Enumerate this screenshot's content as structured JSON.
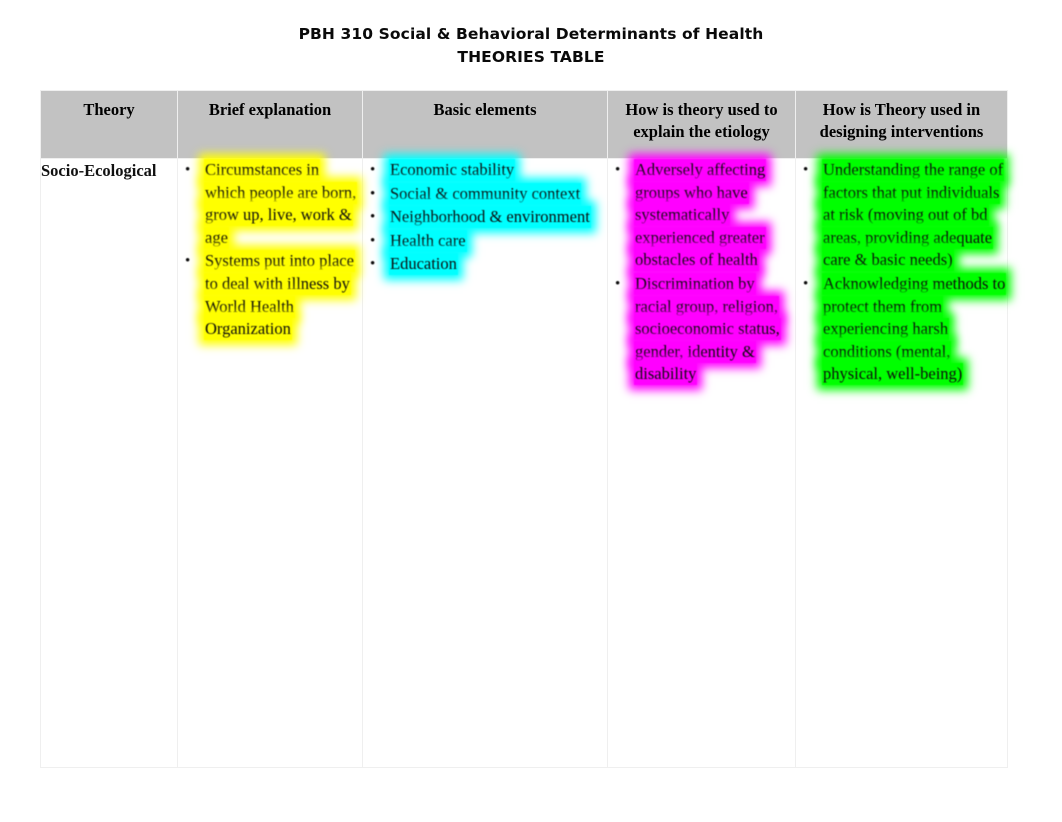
{
  "document": {
    "title_line1": "PBH 310 Social & Behavioral Determinants of Health",
    "title_line2": "THEORIES TABLE"
  },
  "table": {
    "header_background": "#c2c2c2",
    "headers": [
      {
        "label": "Theory"
      },
      {
        "label": "Brief explanation"
      },
      {
        "label": "Basic elements"
      },
      {
        "label": "How is theory used to explain the etiology"
      },
      {
        "label": "How is Theory used in designing interventions"
      }
    ],
    "rows": [
      {
        "theory": "Socio-Ecological",
        "brief_explanation": {
          "highlight_color": "#ffff00",
          "items": [
            "Circumstances in which people are born, grow up, live, work & age",
            "Systems put into place to deal with illness by World Health Organization"
          ]
        },
        "basic_elements": {
          "highlight_color": "#00ffff",
          "items": [
            "Economic stability",
            "Social & community context",
            "Neighborhood & environment",
            "Health care",
            "Education"
          ]
        },
        "etiology": {
          "highlight_color": "#ff00ff",
          "items": [
            "Adversely affecting groups who have systematically experienced greater obstacles of health",
            "Discrimination by racial group, religion, socioeconomic status, gender, identity & disability"
          ]
        },
        "interventions": {
          "highlight_color": "#00ff00",
          "items": [
            "Understanding the range of factors that put individuals at risk (moving out of bd areas, providing adequate care & basic needs)",
            "Acknowledging methods to protect them from experiencing harsh conditions (mental, physical, well-being)"
          ]
        }
      }
    ]
  }
}
